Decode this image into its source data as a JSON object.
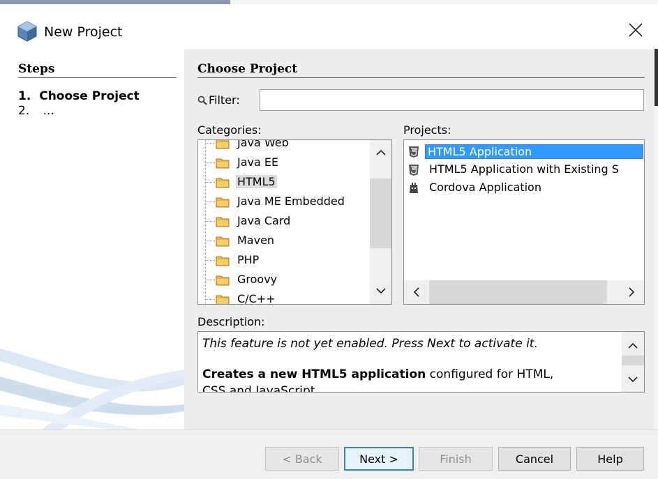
{
  "window": {
    "title": "New Project"
  },
  "steps": {
    "heading": "Steps",
    "items": [
      {
        "number": "1.",
        "label": "Choose Project"
      },
      {
        "number": "2.",
        "label": "..."
      }
    ]
  },
  "main": {
    "heading": "Choose Project",
    "filter_label": "Filter:",
    "filter_value": "",
    "categories_label": "Categories:",
    "projects_label": "Projects:",
    "categories": [
      {
        "label": "Java Web"
      },
      {
        "label": "Java EE"
      },
      {
        "label": "HTML5",
        "selected": true
      },
      {
        "label": "Java ME Embedded"
      },
      {
        "label": "Java Card"
      },
      {
        "label": "Maven"
      },
      {
        "label": "PHP"
      },
      {
        "label": "Groovy"
      },
      {
        "label": "C/C++"
      }
    ],
    "projects": [
      {
        "label": "HTML5 Application",
        "icon": "html5-icon",
        "selected": true
      },
      {
        "label": "HTML5 Application with Existing S",
        "icon": "html5-icon"
      },
      {
        "label": "Cordova Application",
        "icon": "cordova-icon"
      }
    ],
    "description_label": "Description:",
    "description": {
      "line1": "This feature is not yet enabled. Press Next to activate it.",
      "line2_bold": "Creates a new HTML5 application",
      "line2_rest": " configured for HTML,",
      "line3": "CSS and JavaScript."
    }
  },
  "buttons": {
    "back": "< Back",
    "next": "Next >",
    "finish": "Finish",
    "cancel": "Cancel",
    "help": "Help"
  },
  "colors": {
    "selection": "#3399ff",
    "default_button_border": "#3c7fb1"
  }
}
